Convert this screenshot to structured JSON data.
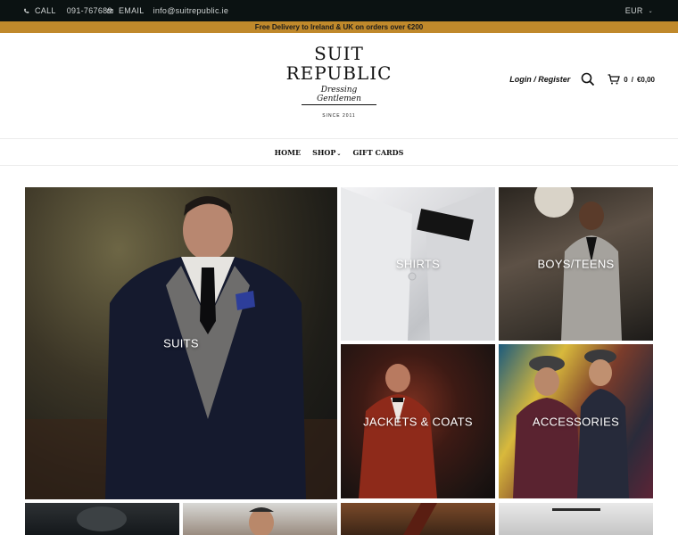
{
  "topbar": {
    "call_label": "CALL",
    "phone": "091-767689",
    "email_label": "EMAIL",
    "email": "info@suitrepublic.ie",
    "currency": "EUR",
    "phone_icon": "phone-icon",
    "email_icon": "mail-icon"
  },
  "promo": {
    "text": "Free Delivery to Ireland & UK on orders over €200"
  },
  "logo": {
    "line1": "SUIT",
    "line2": "REPUBLIC",
    "tagline": "Dressing Gentlemen",
    "since": "SINCE 2011"
  },
  "header": {
    "login_label": "Login / Register",
    "cart_count": "0",
    "cart_total": "€0,00",
    "separator": "/"
  },
  "nav": {
    "items": [
      "HOME",
      "SHOP",
      "GIFT CARDS"
    ]
  },
  "tiles": {
    "suits": "SUITS",
    "shirts": "SHIRTS",
    "boys": "BOYS/TEENS",
    "jackets": "JACKETS & COATS",
    "accessories": "ACCESSORIES"
  },
  "colors": {
    "topbar": "#0b1212",
    "promo": "#c0892b"
  }
}
